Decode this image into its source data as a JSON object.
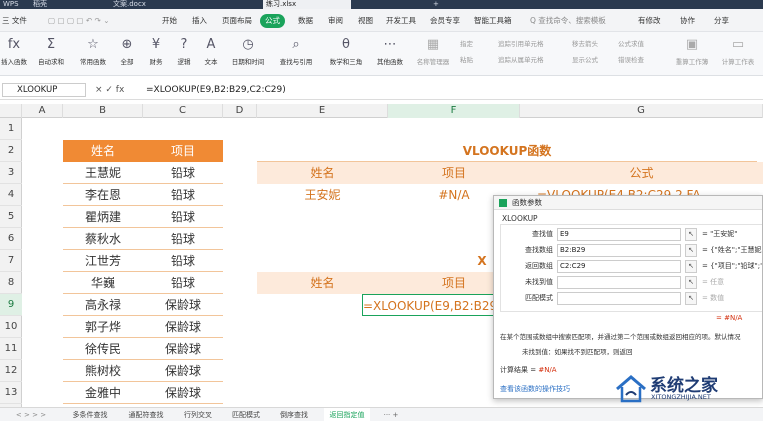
{
  "tabs": {
    "wps": "WPS",
    "home": "稻壳",
    "doc": "文案.docx",
    "xlsx": "练习.xlsx",
    "add": "+"
  },
  "menubar": {
    "file": "三 文件",
    "items": [
      "开始",
      "插入",
      "页面布局",
      "公式",
      "数据",
      "审阅",
      "视图",
      "开发工具",
      "会员专享",
      "智能工具箱"
    ],
    "search_placeholder": "Q 查找命令、搜索模板",
    "right": [
      "有修改",
      "协作",
      "分享"
    ]
  },
  "ribbon": {
    "buttons": [
      "插入函数",
      "自动求和",
      "常用函数",
      "全部",
      "财务",
      "逻辑",
      "文本",
      "日期和时间",
      "查找与引用",
      "数学和三角",
      "其他函数"
    ],
    "right_items": [
      "名称管理器",
      "指定",
      "粘贴",
      "追踪引用单元格",
      "追踪从属单元格",
      "移去箭头",
      "显示公式",
      "错误检查",
      "公式求值",
      "重算工作簿",
      "计算工作表"
    ]
  },
  "formula_bar": {
    "name_box": "XLOOKUP",
    "icons": "× ✓ fx",
    "formula": "=XLOOKUP(E9,B2:B29,C2:C29)"
  },
  "columns": [
    "A",
    "B",
    "C",
    "D",
    "E",
    "F",
    "G"
  ],
  "rows": [
    "1",
    "2",
    "3",
    "4",
    "5",
    "6",
    "7",
    "8",
    "9",
    "10",
    "11",
    "12",
    "13"
  ],
  "table_left": {
    "headers": [
      "姓名",
      "项目"
    ],
    "rows": [
      [
        "王慧妮",
        "铅球"
      ],
      [
        "李在恩",
        "铅球"
      ],
      [
        "瞿炳建",
        "铅球"
      ],
      [
        "蔡秋水",
        "铅球"
      ],
      [
        "江世芳",
        "铅球"
      ],
      [
        "华巍",
        "铅球"
      ],
      [
        "高永禄",
        "保龄球"
      ],
      [
        "郭子烨",
        "保龄球"
      ],
      [
        "徐传民",
        "保龄球"
      ],
      [
        "熊树校",
        "保龄球"
      ],
      [
        "金雅中",
        "保龄球"
      ]
    ]
  },
  "vlookup_section": {
    "title": "VLOOKUP函数",
    "labels": [
      "姓名",
      "项目",
      "公式"
    ],
    "values": [
      "王安妮",
      "#N/A",
      "=VLOOKUP(E4,B2:C29,2,FA"
    ]
  },
  "xlookup_section": {
    "title_fragment": "X",
    "labels": [
      "姓名",
      "项目"
    ],
    "formula": "=XLOOKUP(E9,B2:B29"
  },
  "dialog": {
    "title": "函数参数",
    "function": "XLOOKUP",
    "args": [
      {
        "label": "查找值",
        "value": "E9",
        "result": "= \"王安妮\"",
        "gray": false
      },
      {
        "label": "查找数组",
        "value": "B2:B29",
        "result": "= {\"姓名\";\"王慧妮\";\"",
        "gray": false
      },
      {
        "label": "返回数组",
        "value": "C2:C29",
        "result": "= {\"项目\";\"铅球\";\"铅",
        "gray": false
      },
      {
        "label": "未找到值",
        "value": "",
        "result": "= 任意",
        "gray": true
      },
      {
        "label": "匹配模式",
        "value": "",
        "result": "= 数值",
        "gray": true
      }
    ],
    "result_na": "= #N/A",
    "description": "在某个范围或数组中搜索匹配项，并通过第二个范围或数组返回相应的项。默认情况",
    "param_desc": "未找到值：如果找不到匹配项，则返回",
    "calc_label": "计算结果 = ",
    "calc_value": "#N/A",
    "help_link": "查看该函数的操作技巧"
  },
  "sheets": {
    "nav": "< > > >",
    "tabs": [
      "多条件查找",
      "通配符查找",
      "行列交叉",
      "匹配模式",
      "倒序查找",
      "返回指定值"
    ],
    "active_index": 5,
    "more": "··· +"
  },
  "watermark": {
    "text": "系统之家",
    "sub": "XITONGZHIJIA.NET"
  },
  "colors": {
    "accent_green": "#1aa35b",
    "header_orange": "#f08a34",
    "text_orange": "#d4741f"
  }
}
